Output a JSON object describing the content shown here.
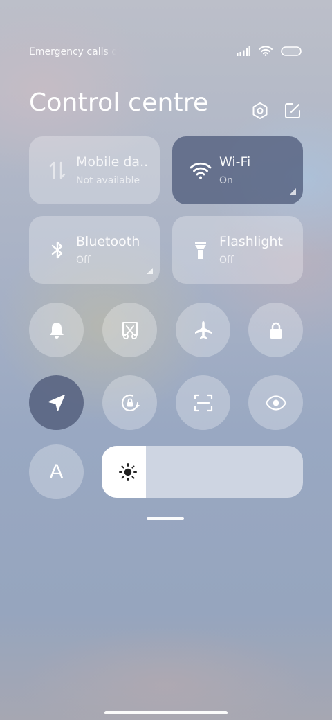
{
  "status_bar": {
    "text": "Emergency calls only",
    "icons": [
      "signal-icon",
      "wifi-icon",
      "battery-icon"
    ]
  },
  "header": {
    "title": "Control centre",
    "icons": [
      "settings-icon",
      "edit-icon"
    ]
  },
  "tiles": [
    {
      "name": "Mobile da..",
      "state": "Not available",
      "icon": "mobile-data-icon",
      "active": false
    },
    {
      "name": "Wi-Fi",
      "state": "On",
      "icon": "wifi-icon",
      "active": true
    },
    {
      "name": "Bluetooth",
      "state": "Off",
      "icon": "bluetooth-icon",
      "active": false
    },
    {
      "name": "Flashlight",
      "state": "Off",
      "icon": "flashlight-icon",
      "active": false
    }
  ],
  "toggles": [
    {
      "icon": "bell-icon",
      "active": false
    },
    {
      "icon": "screenshot-icon",
      "active": false
    },
    {
      "icon": "airplane-icon",
      "active": false
    },
    {
      "icon": "lock-icon",
      "active": false
    },
    {
      "icon": "location-icon",
      "active": true
    },
    {
      "icon": "rotation-lock-icon",
      "active": false
    },
    {
      "icon": "scan-icon",
      "active": false
    },
    {
      "icon": "eye-icon",
      "active": false
    }
  ],
  "auto_brightness": {
    "label": "A",
    "icon": "auto-brightness-icon"
  },
  "brightness": {
    "level": 0.22,
    "icon": "sun-icon"
  },
  "colors": {
    "active_tile": "#566280",
    "tile": "#ffffff47",
    "slider_fill": "#ffffff"
  }
}
